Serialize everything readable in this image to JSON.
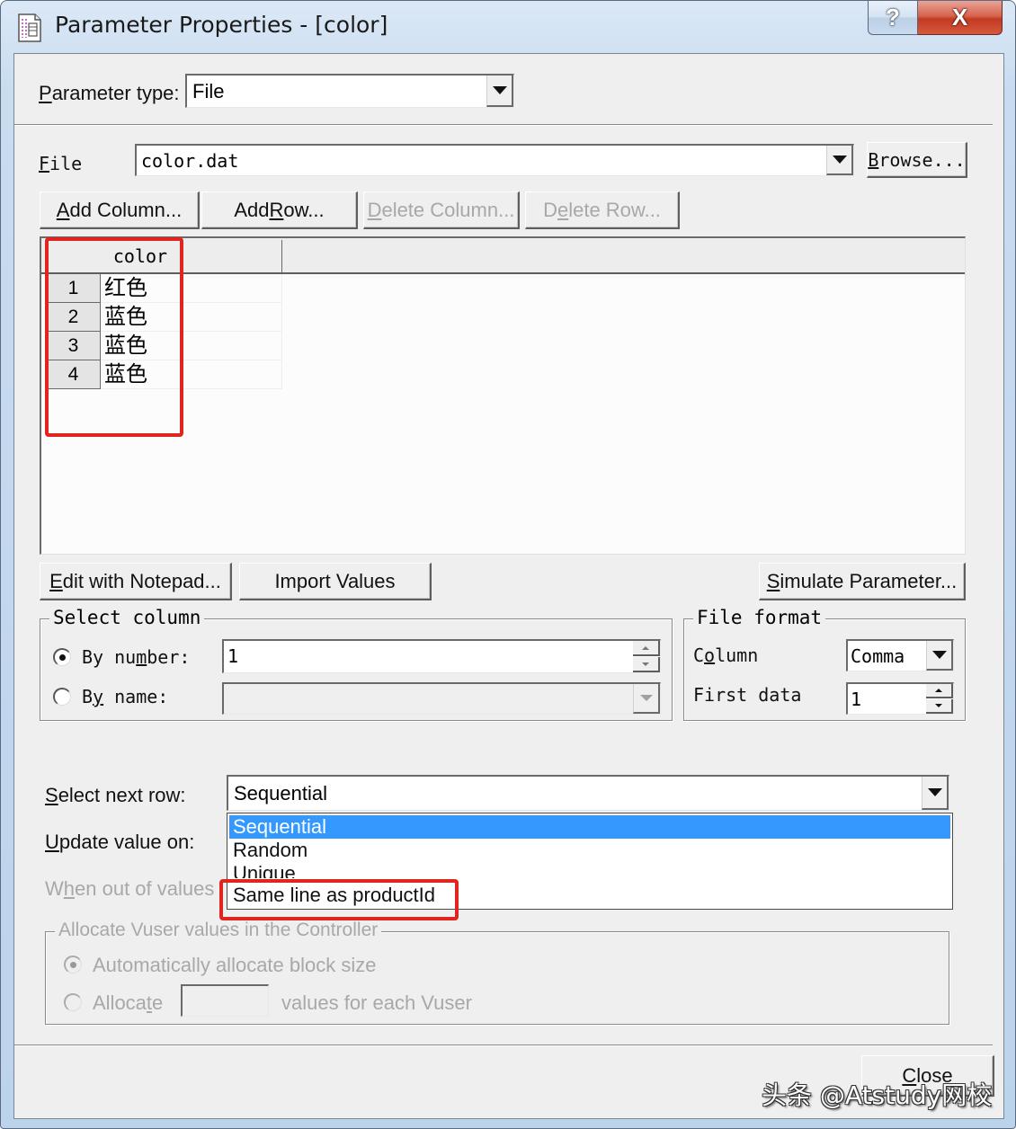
{
  "window": {
    "title": "Parameter Properties - [color]",
    "help_glyph": "?",
    "close_glyph": "X"
  },
  "parameter_type": {
    "label_u": "P",
    "label_rest": "arameter type:",
    "value": "File"
  },
  "file": {
    "label_u": "F",
    "label_rest": "ile",
    "value": "color.dat",
    "browse_u": "B",
    "browse_rest": "rowse..."
  },
  "toolbar": {
    "add_column": {
      "u": "A",
      "rest": "dd Column..."
    },
    "add_row": {
      "pre": "Add ",
      "u": "R",
      "rest": "ow..."
    },
    "delete_column": {
      "u": "D",
      "rest": "elete Column..."
    },
    "delete_row": {
      "pre": "D",
      "u": "e",
      "rest": "lete Row..."
    }
  },
  "table": {
    "columns": [
      "color"
    ],
    "rows": [
      {
        "index": "1",
        "color": "红色"
      },
      {
        "index": "2",
        "color": "蓝色"
      },
      {
        "index": "3",
        "color": "蓝色"
      },
      {
        "index": "4",
        "color": "蓝色"
      }
    ]
  },
  "actions": {
    "edit_notepad": {
      "u": "E",
      "rest": "dit with Notepad..."
    },
    "import_values": "Import Values",
    "simulate": {
      "u": "S",
      "rest": "imulate Parameter..."
    }
  },
  "select_column": {
    "title": "Select column",
    "by_number": {
      "pre": "By nu",
      "u": "m",
      "rest": "ber:",
      "value": "1",
      "checked": true
    },
    "by_name": {
      "pre": "B",
      "u": "y",
      "rest": " name:",
      "value": "",
      "checked": false
    }
  },
  "file_format": {
    "title": "File format",
    "column_label": {
      "pre": "C",
      "u": "o",
      "rest": "lumn"
    },
    "column_value": "Comma",
    "first_data_label": "First data",
    "first_data_value": "1"
  },
  "select_next_row": {
    "label_u": "S",
    "label_rest": "elect next row:",
    "value": "Sequential",
    "options": [
      "Sequential",
      "Random",
      "Unique",
      "Same line as productId"
    ],
    "highlighted": "Sequential"
  },
  "update_value_on": {
    "label_u": "U",
    "label_rest": "pdate value on:"
  },
  "when_out_of_values": {
    "pre": "W",
    "u": "h",
    "rest": "en out of values"
  },
  "allocate": {
    "title": "Allocate Vuser values in the Controller",
    "auto": {
      "label": "Automatically allocate block size",
      "checked": true
    },
    "manual": {
      "pre": "Alloca",
      "u": "t",
      "rest": "e",
      "value": "",
      "suffix": "values for each Vuser",
      "checked": false
    }
  },
  "close_button": {
    "u": "C",
    "rest": "lose"
  },
  "watermark": "头条 @Atstudy网校",
  "colors": {
    "highlight": "#e0251e",
    "selection": "#3399ff",
    "dialog_bg": "#f0efef"
  }
}
